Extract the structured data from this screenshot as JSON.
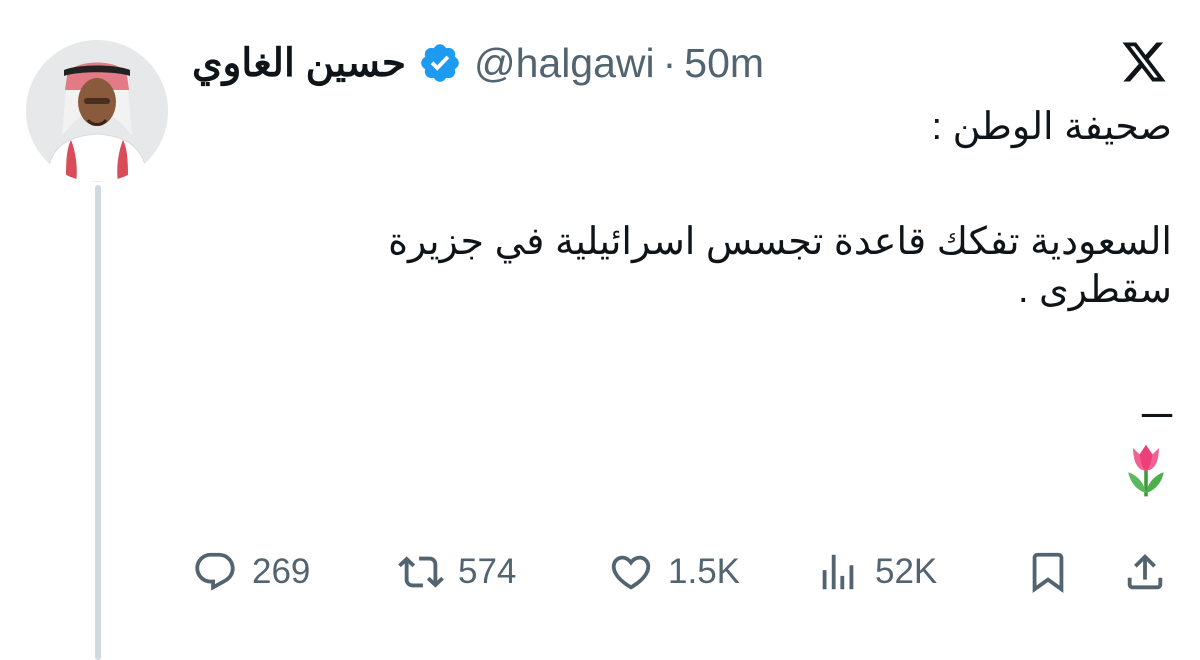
{
  "tweet": {
    "author": {
      "display_name": "حسين الغاوي",
      "handle": "@halgawi",
      "verified": true
    },
    "separator": "·",
    "time": "50m",
    "platform_icon": "x-logo",
    "body": {
      "line1": "صحيفة الوطن :",
      "line2": "السعودية تفكك قاعدة تجسس اسرائيلية في جزيرة",
      "line3": "سقطرى .",
      "dashes": "ـــ",
      "emoji": "tulip-icon"
    },
    "actions": {
      "replies": "269",
      "retweets": "574",
      "likes": "1.5K",
      "views": "52K"
    }
  },
  "colors": {
    "text": "#0f1419",
    "secondary": "#536471",
    "verified": "#1d9bf0",
    "thread_line": "#cfd9de"
  }
}
